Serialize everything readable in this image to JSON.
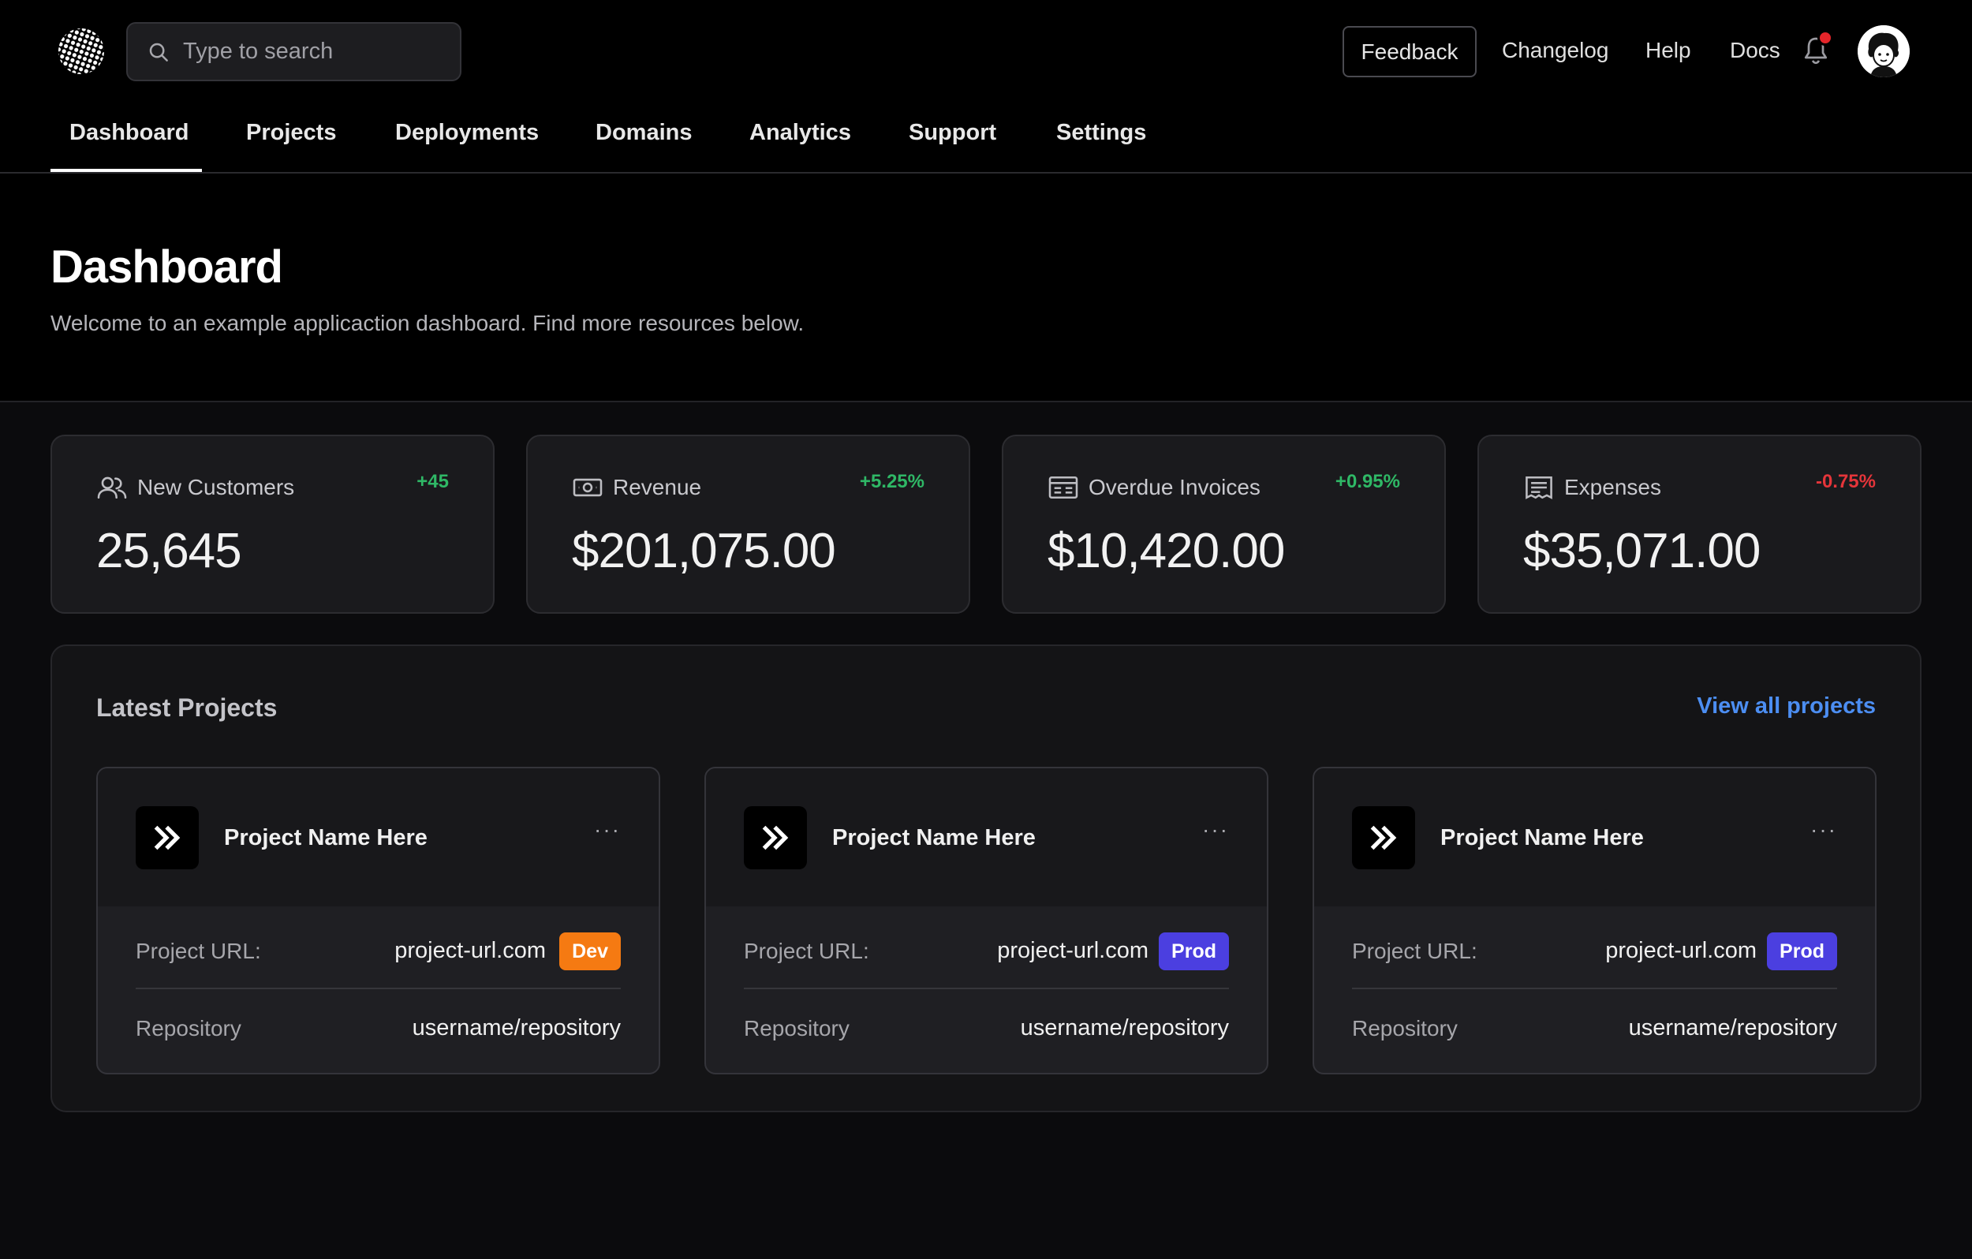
{
  "search": {
    "placeholder": "Type to search"
  },
  "topnav": {
    "feedback": "Feedback",
    "changelog": "Changelog",
    "help": "Help",
    "docs": "Docs"
  },
  "tabs": [
    "Dashboard",
    "Projects",
    "Deployments",
    "Domains",
    "Analytics",
    "Support",
    "Settings"
  ],
  "page": {
    "title": "Dashboard",
    "subtitle": "Welcome to an example applicaction dashboard. Find more resources below."
  },
  "stats": [
    {
      "label": "New Customers",
      "value": "25,645",
      "delta": "+45",
      "delta_color": "#2fb866",
      "icon": "users-icon"
    },
    {
      "label": "Revenue",
      "value": "$201,075.00",
      "delta": "+5.25%",
      "delta_color": "#2fb866",
      "icon": "banknote-icon"
    },
    {
      "label": "Overdue Invoices",
      "value": "$10,420.00",
      "delta": "+0.95%",
      "delta_color": "#2fb866",
      "icon": "invoice-icon"
    },
    {
      "label": "Expenses",
      "value": "$35,071.00",
      "delta": "-0.75%",
      "delta_color": "#e5353a",
      "icon": "receipt-icon"
    }
  ],
  "projects": {
    "title": "Latest Projects",
    "view_all": "View all projects",
    "items": [
      {
        "name": "Project Name Here",
        "menu": "···",
        "url_label": "Project URL:",
        "url": "project-url.com",
        "badge": "Dev",
        "badge_color": "#f57a12",
        "repo_label": "Repository",
        "repo": "username/repository"
      },
      {
        "name": "Project Name Here",
        "menu": "···",
        "url_label": "Project URL:",
        "url": "project-url.com",
        "badge": "Prod",
        "badge_color": "#4b3fe0",
        "repo_label": "Repository",
        "repo": "username/repository"
      },
      {
        "name": "Project Name Here",
        "menu": "···",
        "url_label": "Project URL:",
        "url": "project-url.com",
        "badge": "Prod",
        "badge_color": "#4b3fe0",
        "repo_label": "Repository",
        "repo": "username/repository"
      }
    ]
  }
}
